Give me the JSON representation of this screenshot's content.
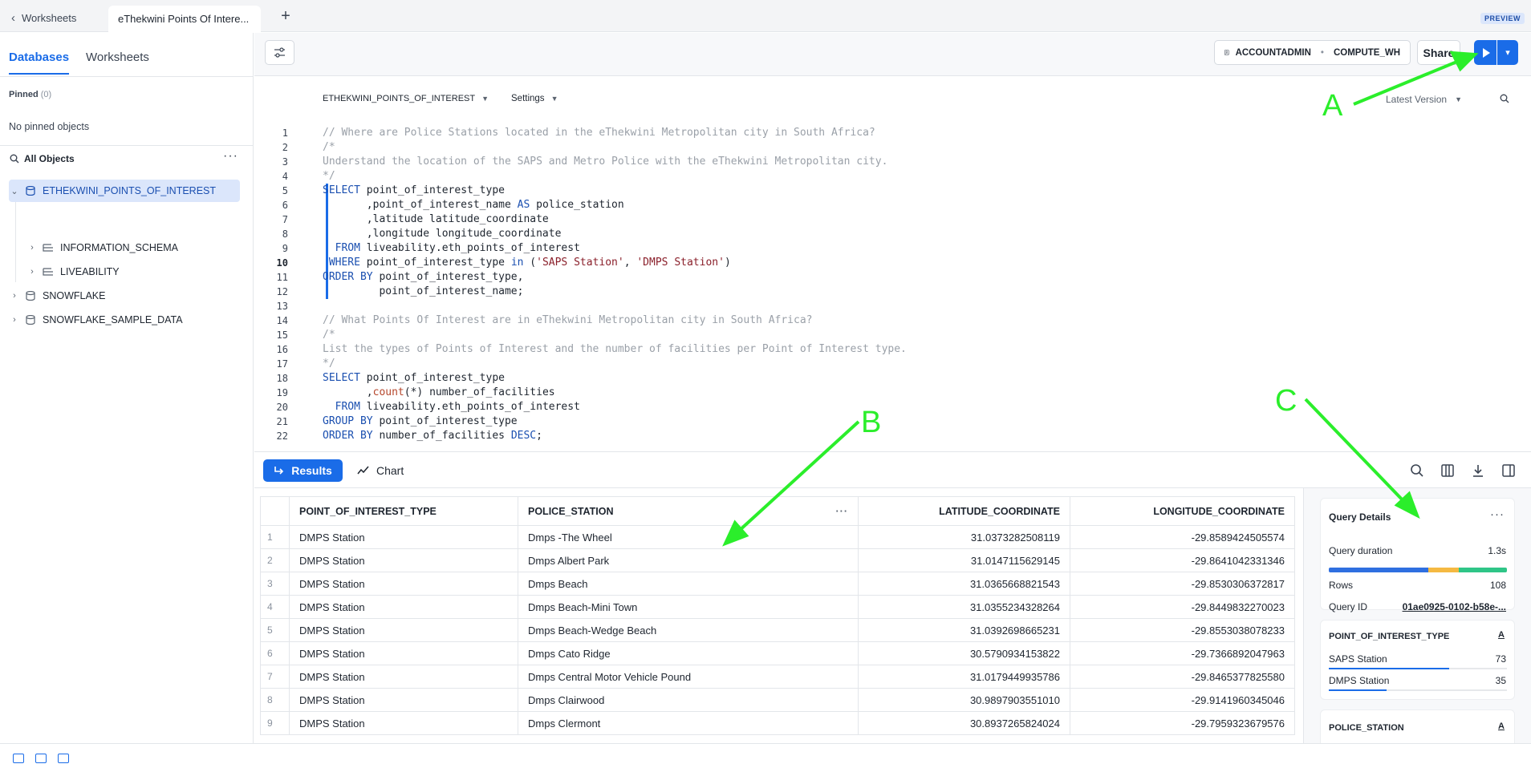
{
  "tabs": {
    "back_label": "Worksheets",
    "active_label": "eThekwini Points Of Intere...",
    "preview_badge": "PREVIEW"
  },
  "sidebar": {
    "tabs": [
      "Databases",
      "Worksheets"
    ],
    "pinned_label": "Pinned",
    "pinned_count": "(0)",
    "no_pinned": "No pinned objects",
    "all_objects": "All Objects",
    "tree": [
      {
        "label": "ETHEKWINI_POINTS_OF_INTEREST",
        "selected": true
      },
      {
        "label": "INFORMATION_SCHEMA"
      },
      {
        "label": "LIVEABILITY"
      },
      {
        "label": "SNOWFLAKE"
      },
      {
        "label": "SNOWFLAKE_SAMPLE_DATA"
      }
    ]
  },
  "toolbar": {
    "role": "ACCOUNTADMIN",
    "warehouse": "COMPUTE_WH",
    "share_label": "Share"
  },
  "editor": {
    "database": "ETHEKWINI_POINTS_OF_INTEREST",
    "settings": "Settings",
    "version": "Latest Version",
    "lines": [
      "// Where are Police Stations located in the eThekwini Metropolitan city in South Africa?",
      "/*",
      "Understand the location of the SAPS and Metro Police with the eThekwini Metropolitan city.",
      "*/",
      "SELECT point_of_interest_type",
      "       ,point_of_interest_name AS police_station",
      "       ,latitude latitude_coordinate",
      "       ,longitude longitude_coordinate",
      "  FROM liveability.eth_points_of_interest",
      " WHERE point_of_interest_type in ('SAPS Station', 'DMPS Station')",
      "ORDER BY point_of_interest_type,",
      "         point_of_interest_name;",
      "",
      "// What Points Of Interest are in eThekwini Metropolitan city in South Africa?",
      "/*",
      "List the types of Points of Interest and the number of facilities per Point of Interest type.",
      "*/",
      "SELECT point_of_interest_type",
      "       ,count(*) number_of_facilities",
      "  FROM liveability.eth_points_of_interest",
      "GROUP BY point_of_interest_type",
      "ORDER BY number_of_facilities DESC;"
    ]
  },
  "results": {
    "results_label": "Results",
    "chart_label": "Chart",
    "columns": [
      "POINT_OF_INTEREST_TYPE",
      "POLICE_STATION",
      "LATITUDE_COORDINATE",
      "LONGITUDE_COORDINATE"
    ],
    "rows": [
      [
        "1",
        "DMPS Station",
        "Dmps -The Wheel",
        "31.0373282508119",
        "-29.8589424505574"
      ],
      [
        "2",
        "DMPS Station",
        "Dmps Albert Park",
        "31.0147115629145",
        "-29.8641042331346"
      ],
      [
        "3",
        "DMPS Station",
        "Dmps Beach",
        "31.0365668821543",
        "-29.8530306372817"
      ],
      [
        "4",
        "DMPS Station",
        "Dmps Beach-Mini Town",
        "31.0355234328264",
        "-29.8449832270023"
      ],
      [
        "5",
        "DMPS Station",
        "Dmps Beach-Wedge Beach",
        "31.0392698665231",
        "-29.8553038078233"
      ],
      [
        "6",
        "DMPS Station",
        "Dmps Cato Ridge",
        "30.5790934153822",
        "-29.7366892047963"
      ],
      [
        "7",
        "DMPS Station",
        "Dmps Central Motor Vehicle Pound",
        "31.0179449935786",
        "-29.8465377825580"
      ],
      [
        "8",
        "DMPS Station",
        "Dmps Clairwood",
        "30.9897903551010",
        "-29.9141960345046"
      ],
      [
        "9",
        "DMPS Station",
        "Dmps Clermont",
        "30.8937265824024",
        "-29.7959323679576"
      ]
    ]
  },
  "query_details": {
    "title": "Query Details",
    "duration_label": "Query duration",
    "duration_value": "1.3s",
    "rows_label": "Rows",
    "rows_value": "108",
    "query_id_label": "Query ID",
    "query_id_value": "01ae0925-0102-b58e-...",
    "duration_segments": [
      {
        "fraction": 0.56,
        "color": "#2f6fe0"
      },
      {
        "fraction": 0.17,
        "color": "#f5b942"
      },
      {
        "fraction": 0.27,
        "color": "#2fc587"
      }
    ],
    "type_card": {
      "title": "POINT_OF_INTEREST_TYPE",
      "type_badge": "A",
      "items": [
        {
          "label": "SAPS Station",
          "count": "73",
          "fraction": 0.676
        },
        {
          "label": "DMPS Station",
          "count": "35",
          "fraction": 0.324
        }
      ]
    },
    "station_card": {
      "title": "POLICE_STATION",
      "type_badge": "A"
    }
  },
  "annotations": {
    "a": "A",
    "b": "B",
    "c": "C",
    "color": "#2bee2b"
  }
}
